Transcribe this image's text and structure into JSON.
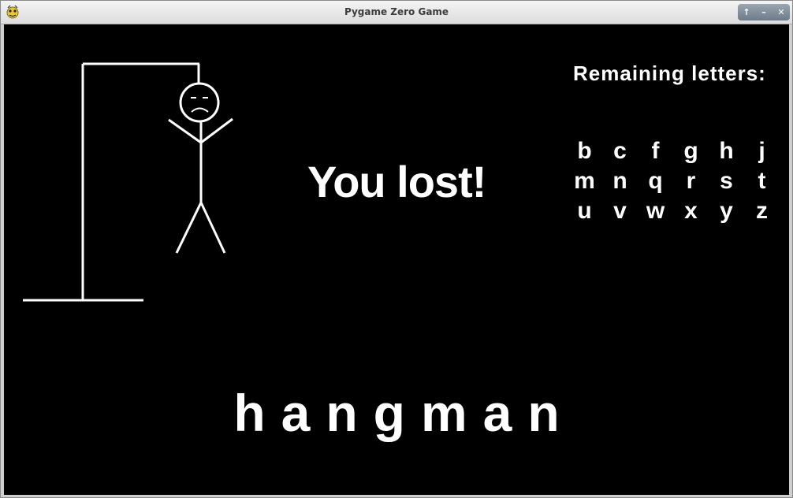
{
  "window": {
    "title": "Pygame Zero Game",
    "buttons": {
      "restore": "↑",
      "minimize": "–",
      "close": "✕"
    }
  },
  "game": {
    "status": "You lost!",
    "remaining_title": "Remaining letters:",
    "remaining_letters": [
      "b",
      "c",
      "f",
      "g",
      "h",
      "j",
      "m",
      "n",
      "q",
      "r",
      "s",
      "t",
      "u",
      "v",
      "w",
      "x",
      "y",
      "z"
    ],
    "word": "hangman",
    "colors": {
      "background": "#000000",
      "foreground": "#ffffff"
    },
    "hangman_parts": [
      "gallows-base",
      "gallows-post",
      "gallows-beam",
      "rope",
      "head",
      "body",
      "left-arm",
      "right-arm",
      "left-leg",
      "right-leg",
      "sad-face"
    ]
  }
}
